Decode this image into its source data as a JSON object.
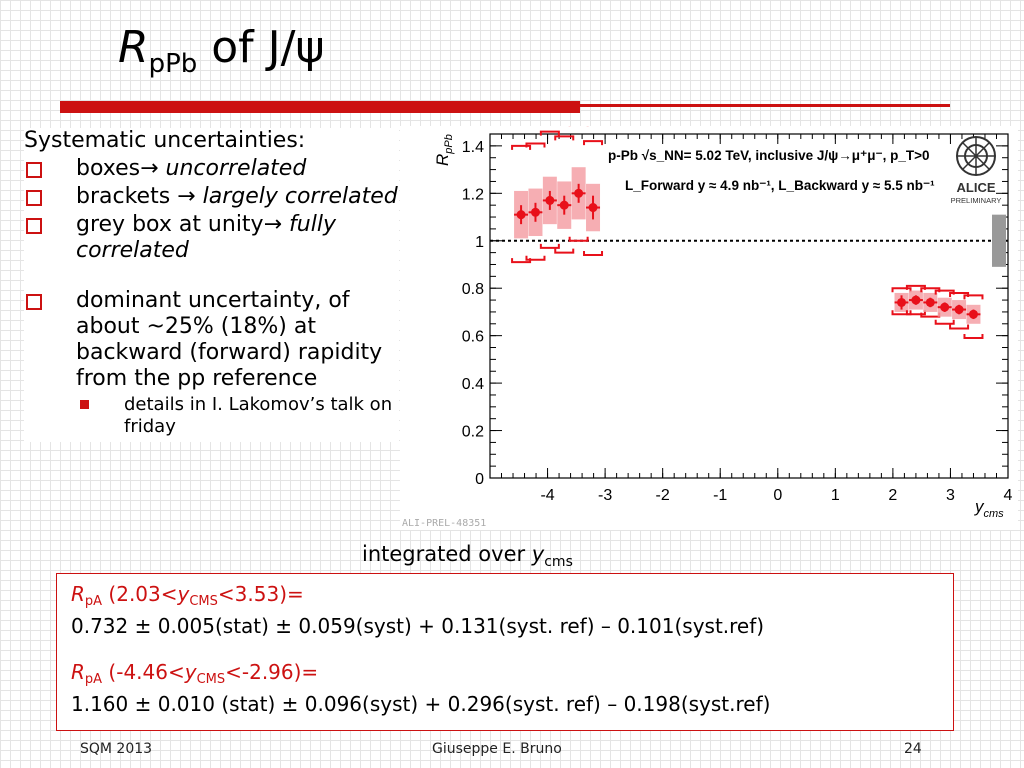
{
  "slide": {
    "title_r": "R",
    "title_sub": "pPb",
    "title_rest": " of J/ψ",
    "bullets": {
      "header": "Systematic uncertainties:",
      "items": [
        {
          "text": "boxes",
          "arrow": "→",
          "italic": " uncorrelated"
        },
        {
          "text": "brackets ",
          "arrow": "→",
          "italic": " largely correlated"
        },
        {
          "text": "grey box at unity",
          "arrow": "→",
          "italic": " fully correlated"
        },
        {
          "text": "dominant uncertainty, of about ~25% (18%) at backward (forward) rapidity from the pp reference"
        }
      ],
      "subitem": "details in I. Lakomov’s talk on friday"
    },
    "caption_text": "integrated over ",
    "caption_y": "y",
    "caption_sub": "cms",
    "results": {
      "r1_r": "R",
      "r1_sub": "pA",
      "r1_range_a": " (2.03<",
      "r1_y": "y",
      "r1_ysub": "CMS",
      "r1_range_b": "<3.53)=",
      "r1_value": "0.732 ± 0.005(stat) ± 0.059(syst) + 0.131(syst. ref) – 0.101(syst.ref)",
      "r2_r": "R",
      "r2_sub": "pA",
      "r2_range_a": " (-4.46<",
      "r2_y": "y",
      "r2_ysub": "CMS",
      "r2_range_b": "<-2.96)=",
      "r2_value": "1.160 ± 0.010 (stat) ± 0.096(syst) + 0.296(syst. ref) – 0.198(syst.ref)"
    },
    "footer": {
      "left": "SQM 2013",
      "center": "Giuseppe E. Bruno",
      "right": "24"
    },
    "colors": {
      "accent": "#cc1111",
      "marker": "#e8101a",
      "stat_box": "#f5a0a6",
      "global_box": "#999999"
    }
  },
  "chart_data": {
    "type": "scatter",
    "xlim": [
      -5,
      4
    ],
    "ylim": [
      0,
      1.45
    ],
    "xticks": [
      "-4",
      "-3",
      "-2",
      "-1",
      "0",
      "1",
      "2",
      "3",
      "4"
    ],
    "yticks": [
      "0",
      "0.2",
      "0.4",
      "0.6",
      "0.8",
      "1",
      "1.2",
      "1.4"
    ],
    "ylabel_main": "R",
    "ylabel_sub": "pPb",
    "xlabel_main": "y",
    "xlabel_sub": "cms",
    "legend_line1": "p-Pb  √s_NN= 5.02 TeV, inclusive J/ψ→μ⁺μ⁻, p_T>0",
    "legend_line2": "L_Forward y ≈ 4.9 nb⁻¹, L_Backward y ≈ 5.5 nb⁻¹",
    "logo_text": "ALICE",
    "logo_sub": "PRELIMINARY",
    "prelim_label": "ALI-PREL-48351",
    "reference_line": 1.0,
    "global_box": [
      0.89,
      1.11
    ],
    "series": [
      {
        "points": [
          {
            "x": -4.46,
            "y": 1.11,
            "stat": 0.04,
            "box": 0.1,
            "brk_lo": 0.2,
            "brk_hi": 0.29
          },
          {
            "x": -4.21,
            "y": 1.12,
            "stat": 0.04,
            "box": 0.1,
            "brk_lo": 0.2,
            "brk_hi": 0.29
          },
          {
            "x": -3.96,
            "y": 1.17,
            "stat": 0.04,
            "box": 0.1,
            "brk_lo": 0.2,
            "brk_hi": 0.29
          },
          {
            "x": -3.71,
            "y": 1.15,
            "stat": 0.04,
            "box": 0.1,
            "brk_lo": 0.2,
            "brk_hi": 0.29
          },
          {
            "x": -3.46,
            "y": 1.2,
            "stat": 0.04,
            "box": 0.11,
            "brk_lo": 0.2,
            "brk_hi": 0.3
          },
          {
            "x": -3.21,
            "y": 1.14,
            "stat": 0.05,
            "box": 0.1,
            "brk_lo": 0.2,
            "brk_hi": 0.28
          }
        ]
      },
      {
        "points": [
          {
            "x": 2.15,
            "y": 0.74,
            "stat": 0.03,
            "box": 0.04,
            "brk_lo": 0.05,
            "brk_hi": 0.06
          },
          {
            "x": 2.4,
            "y": 0.75,
            "stat": 0.02,
            "box": 0.04,
            "brk_lo": 0.06,
            "brk_hi": 0.06
          },
          {
            "x": 2.65,
            "y": 0.74,
            "stat": 0.02,
            "box": 0.04,
            "brk_lo": 0.06,
            "brk_hi": 0.06
          },
          {
            "x": 2.9,
            "y": 0.72,
            "stat": 0.02,
            "box": 0.04,
            "brk_lo": 0.07,
            "brk_hi": 0.07
          },
          {
            "x": 3.15,
            "y": 0.71,
            "stat": 0.02,
            "box": 0.04,
            "brk_lo": 0.08,
            "brk_hi": 0.07
          },
          {
            "x": 3.4,
            "y": 0.69,
            "stat": 0.02,
            "box": 0.04,
            "brk_lo": 0.1,
            "brk_hi": 0.08
          }
        ]
      }
    ]
  }
}
